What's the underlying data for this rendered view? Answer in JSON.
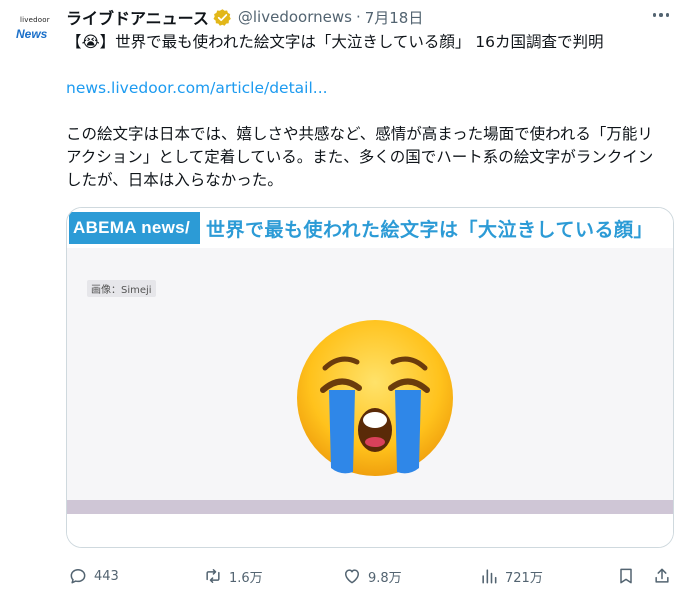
{
  "account": {
    "avatar_top": "livedoor",
    "avatar_bottom": "News",
    "display_name": "ライブドアニュース",
    "handle": "@livedoornews",
    "separator": "·",
    "date": "7月18日"
  },
  "tweet": {
    "line1": "【😭】世界で最も使われた絵文字は「大泣きしている顔」 16カ国調査で判明",
    "link": "news.livedoor.com/article/detail...",
    "body": "この絵文字は日本では、嬉しさや共感など、感情が高まった場面で使われる「万能リアクション」として定着している。また、多くの国でハート系の絵文字がランクインしたが、日本は入らなかった。"
  },
  "card": {
    "logo": "ABEMA news/",
    "headline": "世界で最も使われた絵文字は「大泣きしている顔」",
    "credit": "画像：Simeji"
  },
  "actions": {
    "replies": "443",
    "retweets": "1.6万",
    "likes": "9.8万",
    "views": "721万"
  },
  "colors": {
    "link": "#1d9bf0",
    "abema_blue": "#2c9bd6",
    "verified_gold": "#e2b719"
  }
}
